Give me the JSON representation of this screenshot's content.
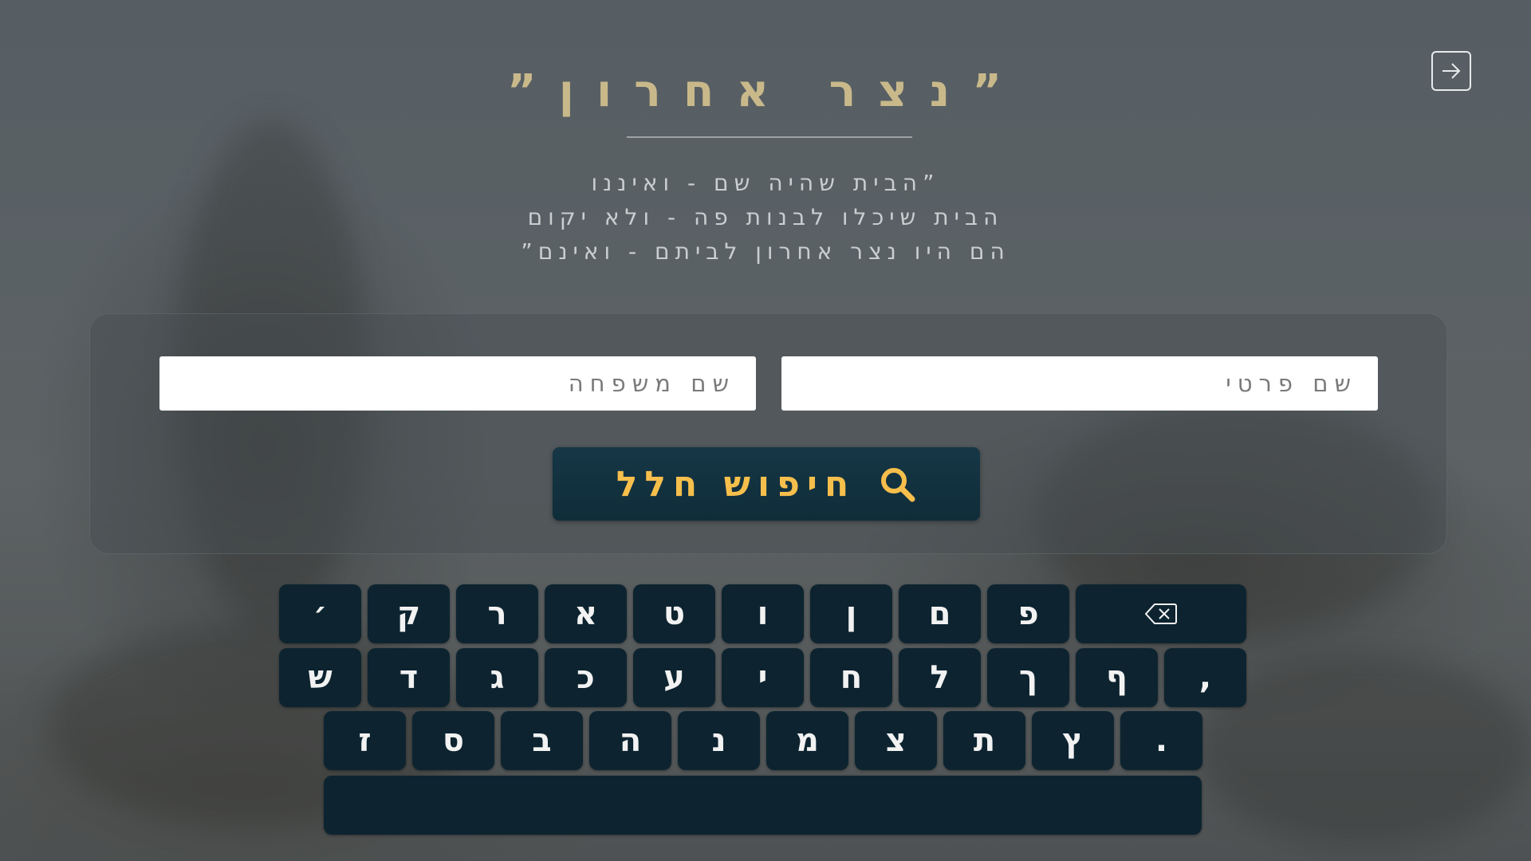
{
  "header": {
    "title": "”נצר אחרון”",
    "exit_icon": "arrow-right-box-icon"
  },
  "quote": {
    "line1": "”הבית שהיה שם - ואיננו",
    "line2": "הבית שיכלו לבנות פה - ולא יקום",
    "line3": "הם היו נצר אחרון לביתם - ואינם”"
  },
  "form": {
    "first_name_placeholder": "שם פרטי",
    "last_name_placeholder": "שם משפחה",
    "search_label": "חיפוש חלל",
    "search_icon": "search-icon",
    "accent_color": "#f6bf4c"
  },
  "keyboard": {
    "row1": [
      "backspace",
      "פ",
      "ם",
      "ן",
      "ו",
      "ט",
      "א",
      "ר",
      "ק",
      "׳"
    ],
    "row2": [
      ",",
      "ף",
      "ך",
      "ל",
      "ח",
      "י",
      "ע",
      "כ",
      "ג",
      "ד",
      "ש"
    ],
    "row3": [
      ".",
      "ץ",
      "ת",
      "צ",
      "מ",
      "נ",
      "ה",
      "ב",
      "ס",
      "ז"
    ],
    "backspace_icon": "backspace-icon",
    "space_label": ""
  }
}
